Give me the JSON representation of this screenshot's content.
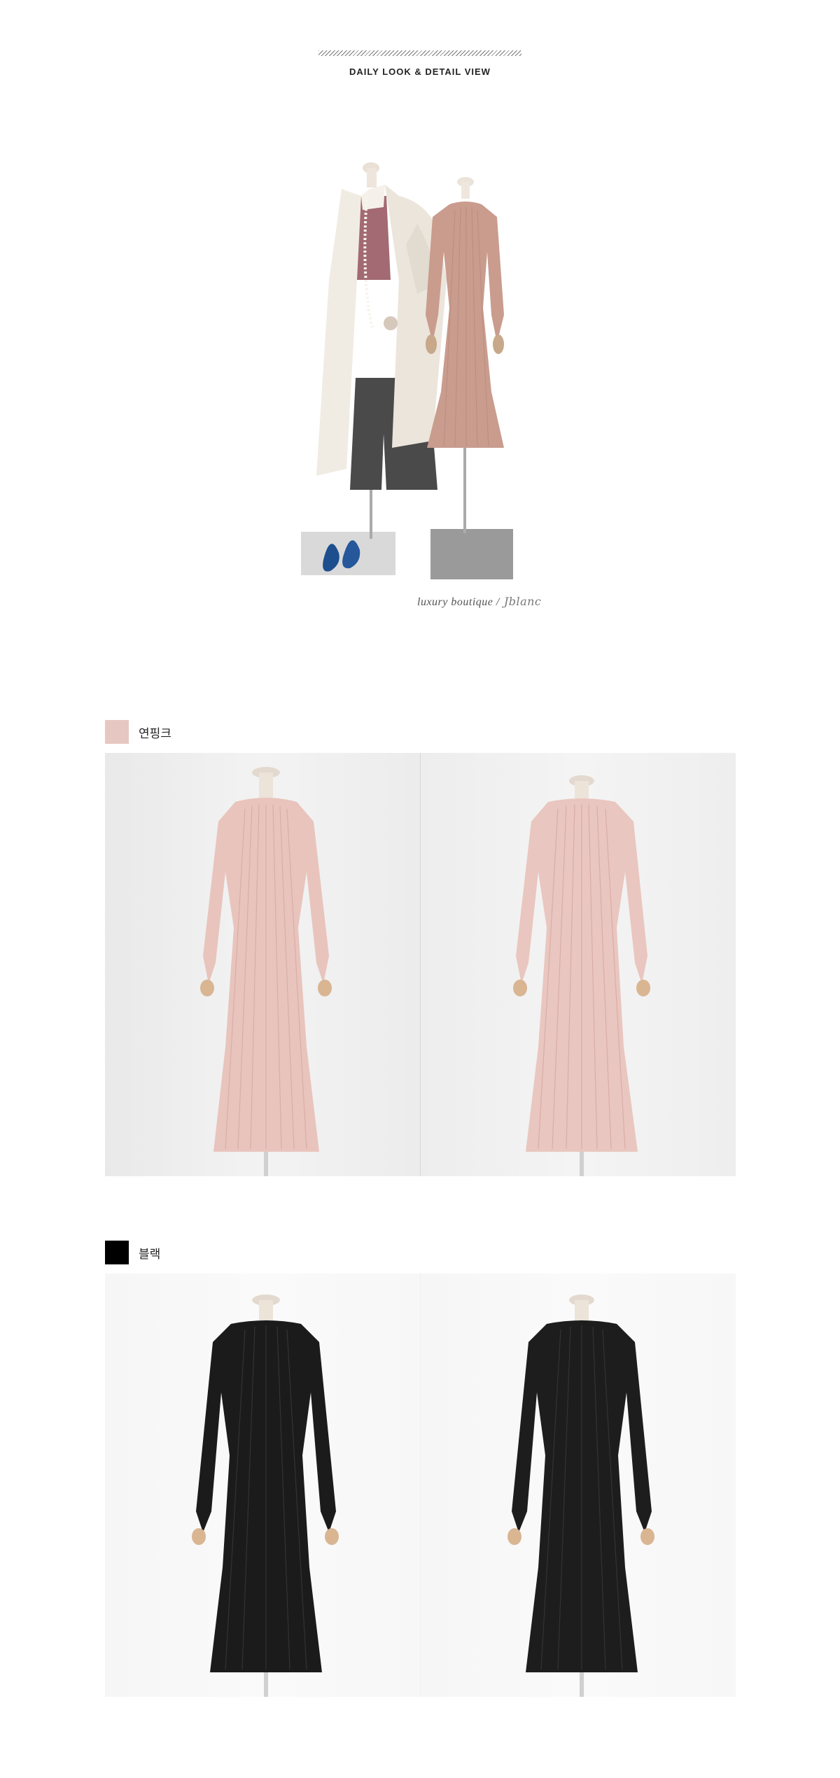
{
  "header": {
    "section_title": "DAILY LOOK & DETAIL VIEW"
  },
  "signature": {
    "text": "luxury boutique  /",
    "mark": "Jblanc"
  },
  "colors": {
    "pink_swatch": "#e7c7c1",
    "black_swatch": "#000000",
    "pink_dress": "#e8c4bd",
    "black_dress": "#1b1b1b",
    "hero_dress": "#c99c8e",
    "coat": "#f0ebe2"
  },
  "color_options": [
    {
      "label": "연핑크",
      "swatch": "#e7c7c1"
    },
    {
      "label": "블랙",
      "swatch": "#000000"
    }
  ]
}
